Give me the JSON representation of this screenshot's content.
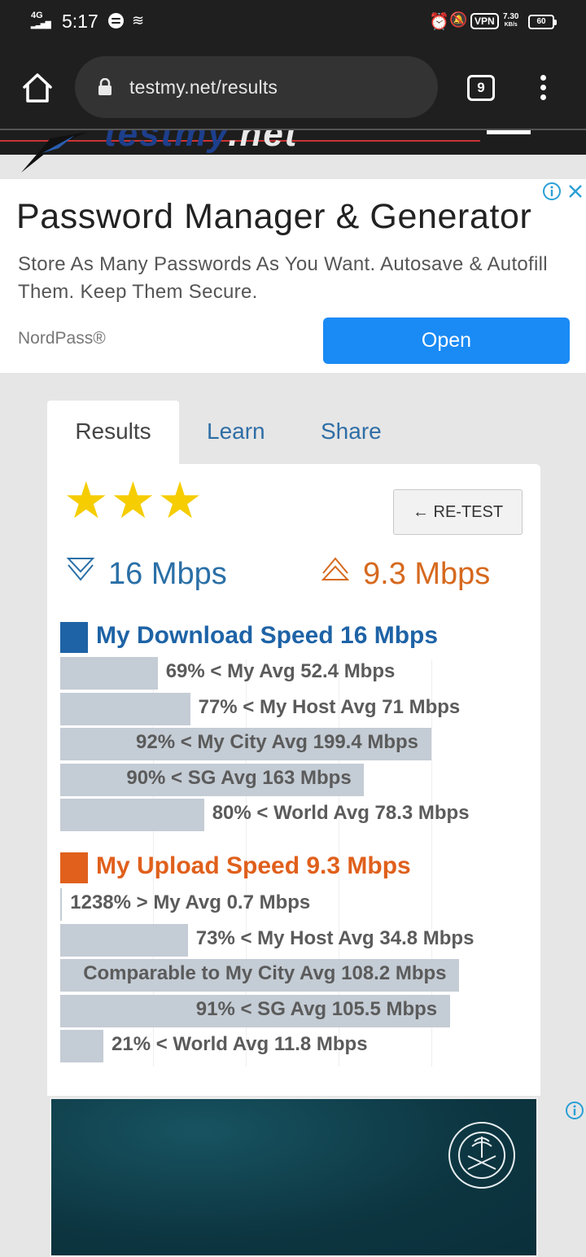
{
  "status_bar": {
    "network": "4G",
    "time": "5:17",
    "vpn": "VPN",
    "net_speed": "7.30",
    "net_speed_unit": "KB/s",
    "battery": "60"
  },
  "browser": {
    "url": "testmy.net/results",
    "tab_count": "9"
  },
  "site": {
    "logo_left": "testmy",
    "logo_right": ".net"
  },
  "ad": {
    "title": "Password Manager & Generator",
    "description": "Store As Many Passwords As You Want. Autosave & Autofill Them. Keep Them Secure.",
    "brand": "NordPass®",
    "cta": "Open"
  },
  "tabs": [
    {
      "label": "Results",
      "active": true
    },
    {
      "label": "Learn",
      "active": false
    },
    {
      "label": "Share",
      "active": false
    }
  ],
  "results": {
    "rating_stars": 3,
    "retest_label": "← RE-TEST",
    "download_speed": "16 Mbps",
    "upload_speed": "9.3 Mbps",
    "download_section": {
      "title": "My Download Speed 16 Mbps",
      "color": "#1e63a6",
      "rows": [
        {
          "label": "69% < My Avg 52.4 Mbps",
          "fill": 0.21,
          "label_inside": false
        },
        {
          "label": "77% < My Host Avg 71 Mbps",
          "fill": 0.28,
          "label_inside": false
        },
        {
          "label": "92% < My City Avg 199.4 Mbps",
          "fill": 0.8,
          "label_inside": true
        },
        {
          "label": "90% < SG Avg 163 Mbps",
          "fill": 0.655,
          "label_inside": true
        },
        {
          "label": "80% < World Avg 78.3 Mbps",
          "fill": 0.31,
          "label_inside": false
        }
      ]
    },
    "upload_section": {
      "title": "My Upload Speed 9.3 Mbps",
      "color": "#e0601c",
      "rows": [
        {
          "label": "1238% > My Avg 0.7 Mbps",
          "fill": 0.004,
          "label_inside": false
        },
        {
          "label": "73% < My Host Avg 34.8 Mbps",
          "fill": 0.275,
          "label_inside": false
        },
        {
          "label": "Comparable to My City Avg 108.2 Mbps",
          "fill": 0.86,
          "label_inside": true
        },
        {
          "label": "91% < SG Avg 105.5 Mbps",
          "fill": 0.84,
          "label_inside": true
        },
        {
          "label": "21% < World Avg 11.8 Mbps",
          "fill": 0.093,
          "label_inside": false
        }
      ]
    }
  },
  "colors": {
    "link_blue": "#2f6ea6",
    "upload_orange": "#d6691e",
    "ad_button": "#1a8af5",
    "star": "#f5cd00",
    "bar": "#c4ccd5"
  }
}
